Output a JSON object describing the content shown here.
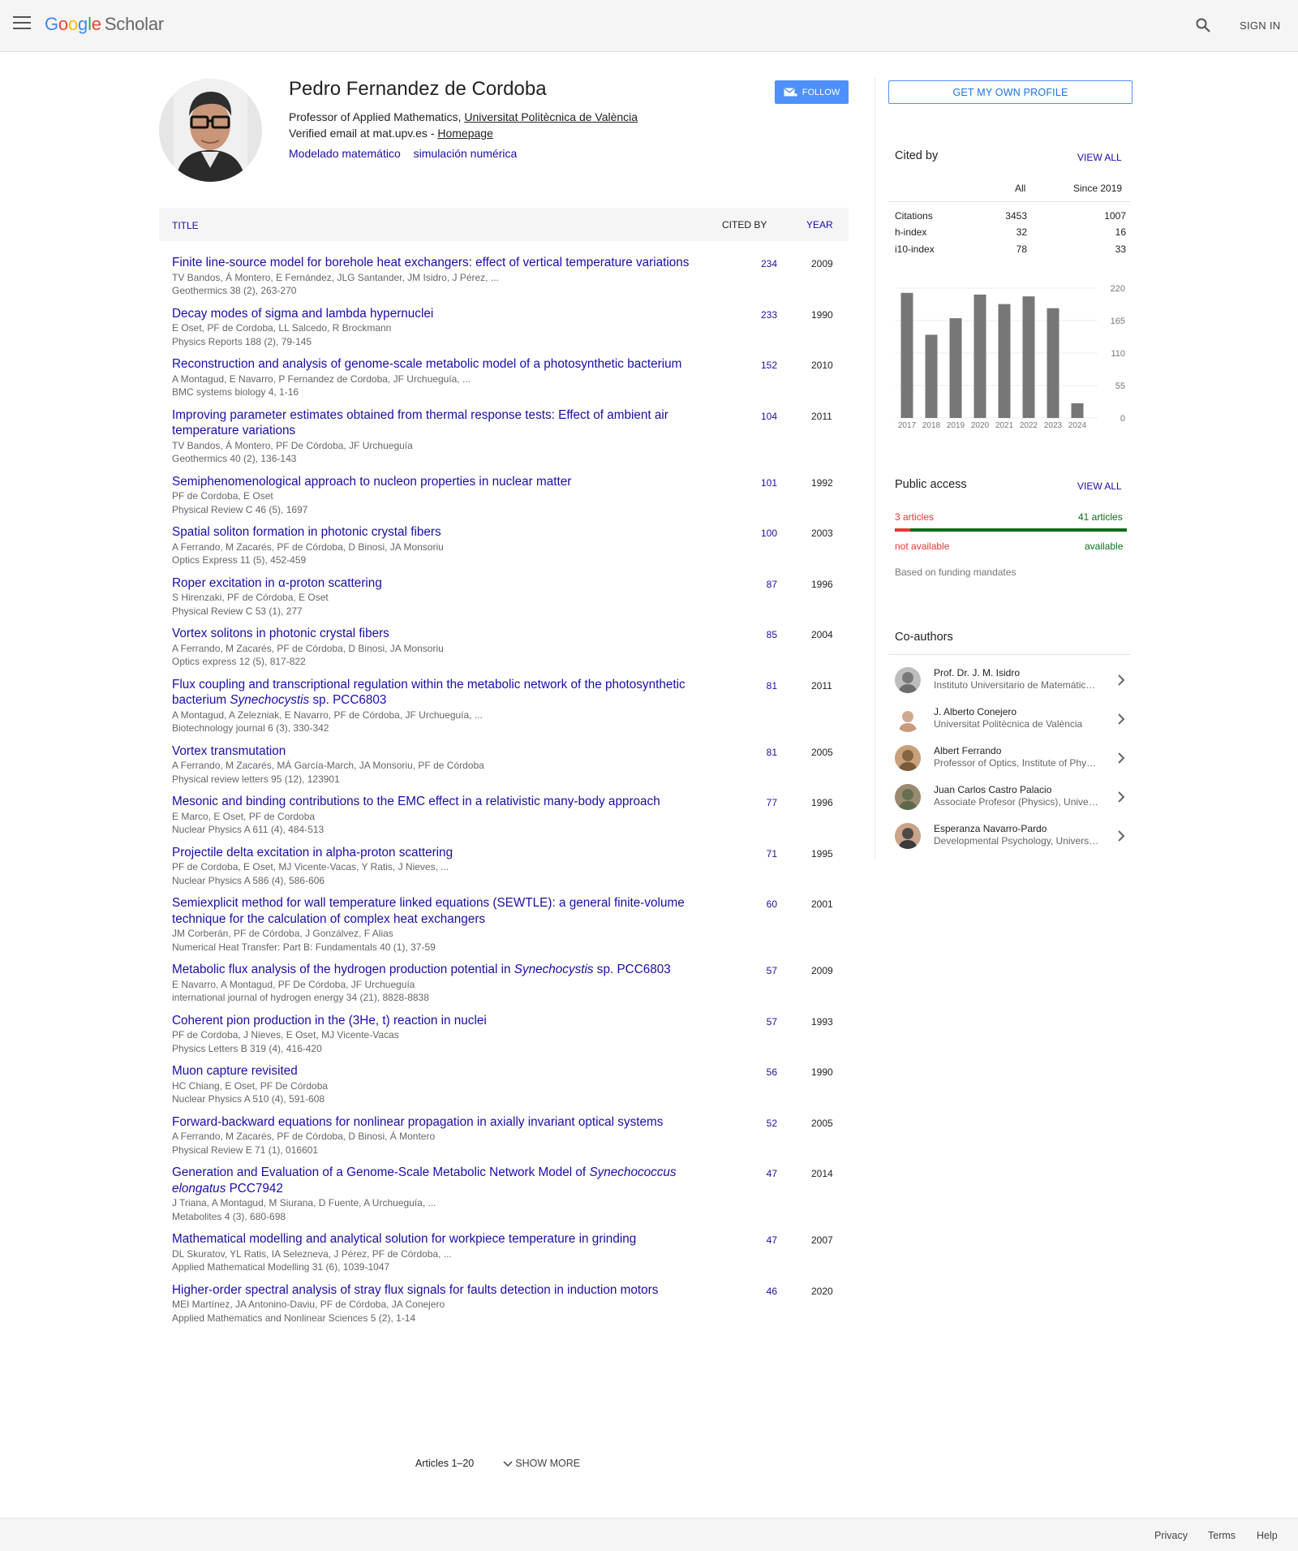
{
  "header": {
    "logo_google": "Google",
    "logo_product": "Scholar",
    "signin_label": "SIGN IN",
    "icons": [
      "menu-icon",
      "search-icon"
    ]
  },
  "profile": {
    "name": "Pedro Fernandez de Cordoba",
    "affiliation_prefix": "Professor of Applied Mathematics, ",
    "affiliation_link": "Universitat Politècnica de València",
    "email_text": "Verified email at mat.upv.es - ",
    "homepage_label": "Homepage",
    "interests": [
      "Modelado matemático",
      "simulación numérica"
    ],
    "follow_label": "FOLLOW"
  },
  "table": {
    "col_title": "TITLE",
    "col_cited": "CITED BY",
    "col_year": "YEAR",
    "rows": [
      {
        "title": "Finite line-source model for borehole heat exchangers: effect of vertical temperature variations",
        "authors": "TV Bandos, Á Montero, E Fernández, JLG Santander, JM Isidro, J Pérez, ...",
        "venue": "Geothermics 38 (2), 263-270",
        "cited": "234",
        "year": "2009"
      },
      {
        "title": "Decay modes of sigma and lambda hypernuclei",
        "authors": "E Oset, PF de Cordoba, LL Salcedo, R Brockmann",
        "venue": "Physics Reports 188 (2), 79-145",
        "cited": "233",
        "year": "1990"
      },
      {
        "title": "Reconstruction and analysis of genome-scale metabolic model of a photosynthetic bacterium",
        "authors": "A Montagud, E Navarro, P Fernandez de Cordoba, JF Urchueguía, ...",
        "venue": "BMC systems biology 4, 1-16",
        "cited": "152",
        "year": "2010"
      },
      {
        "title": "Improving parameter estimates obtained from thermal response tests: Effect of ambient air temperature variations",
        "authors": "TV Bandos, Á Montero, PF De Córdoba, JF Urchueguía",
        "venue": "Geothermics 40 (2), 136-143",
        "cited": "104",
        "year": "2011"
      },
      {
        "title": "Semiphenomenological approach to nucleon properties in nuclear matter",
        "authors": "PF de Cordoba, E Oset",
        "venue": "Physical Review C 46 (5), 1697",
        "cited": "101",
        "year": "1992"
      },
      {
        "title": "Spatial soliton formation in photonic crystal fibers",
        "authors": "A Ferrando, M Zacarés, PF de Córdoba, D Binosi, JA Monsoriu",
        "venue": "Optics Express 11 (5), 452-459",
        "cited": "100",
        "year": "2003"
      },
      {
        "title": "Roper excitation in α-proton scattering",
        "authors": "S Hirenzaki, PF de Córdoba, E Oset",
        "venue": "Physical Review C 53 (1), 277",
        "cited": "87",
        "year": "1996"
      },
      {
        "title": "Vortex solitons in photonic crystal fibers",
        "authors": "A Ferrando, M Zacarés, PF de Córdoba, D Binosi, JA Monsoriu",
        "venue": "Optics express 12 (5), 817-822",
        "cited": "85",
        "year": "2004"
      },
      {
        "title": "Flux coupling and transcriptional regulation within the metabolic network of the photosynthetic bacterium Synechocystis sp. PCC6803",
        "authors": "A Montagud, A Zelezniak, E Navarro, PF de Córdoba, JF Urchueguía, ...",
        "venue": "Biotechnology journal 6 (3), 330-342",
        "cited": "81",
        "year": "2011"
      },
      {
        "title": "Vortex transmutation",
        "authors": "A Ferrando, M Zacarés, MÁ García-March, JA Monsoriu, PF de Córdoba",
        "venue": "Physical review letters 95 (12), 123901",
        "cited": "81",
        "year": "2005"
      },
      {
        "title": "Mesonic and binding contributions to the EMC effect in a relativistic many-body approach",
        "authors": "E Marco, E Oset, PF de Cordoba",
        "venue": "Nuclear Physics A 611 (4), 484-513",
        "cited": "77",
        "year": "1996"
      },
      {
        "title": "Projectile delta excitation in alpha-proton scattering",
        "authors": "PF de Cordoba, E Oset, MJ Vicente-Vacas, Y Ratis, J Nieves, ...",
        "venue": "Nuclear Physics A 586 (4), 586-606",
        "cited": "71",
        "year": "1995"
      },
      {
        "title": "Semiexplicit method for wall temperature linked equations (SEWTLE): a general finite-volume technique for the calculation of complex heat exchangers",
        "authors": "JM Corberán, PF de Córdoba, J Gonzálvez, F Alias",
        "venue": "Numerical Heat Transfer: Part B: Fundamentals 40 (1), 37-59",
        "cited": "60",
        "year": "2001"
      },
      {
        "title": "Metabolic flux analysis of the hydrogen production potential in Synechocystis sp. PCC6803",
        "authors": "E Navarro, A Montagud, PF De Córdoba, JF Urchueguía",
        "venue": "international journal of hydrogen energy 34 (21), 8828-8838",
        "cited": "57",
        "year": "2009"
      },
      {
        "title": "Coherent pion production in the (3He, t) reaction in nuclei",
        "authors": "PF de Cordoba, J Nieves, E Oset, MJ Vicente-Vacas",
        "venue": "Physics Letters B 319 (4), 416-420",
        "cited": "57",
        "year": "1993"
      },
      {
        "title": "Muon capture revisited",
        "authors": "HC Chiang, E Oset, PF De Córdoba",
        "venue": "Nuclear Physics A 510 (4), 591-608",
        "cited": "56",
        "year": "1990"
      },
      {
        "title": "Forward-backward equations for nonlinear propagation in axially invariant optical systems",
        "authors": "A Ferrando, M Zacarés, PF de Córdoba, D Binosi, Á Montero",
        "venue": "Physical Review E 71 (1), 016601",
        "cited": "52",
        "year": "2005"
      },
      {
        "title": "Generation and Evaluation of a Genome-Scale Metabolic Network Model of Synechococcus elongatus PCC7942",
        "authors": "J Triana, A Montagud, M Siurana, D Fuente, A Urchueguía, ...",
        "venue": "Metabolites 4 (3), 680-698",
        "cited": "47",
        "year": "2014"
      },
      {
        "title": "Mathematical modelling and analytical solution for workpiece temperature in grinding",
        "authors": "DL Skuratov, YL Ratis, IA Selezneva, J Pérez, PF de Córdoba, ...",
        "venue": "Applied Mathematical Modelling 31 (6), 1039-1047",
        "cited": "47",
        "year": "2007"
      },
      {
        "title": "Higher-order spectral analysis of stray flux signals for faults detection in induction motors",
        "authors": "MEI Martínez, JA Antonino-Daviu, PF de Córdoba, JA Conejero",
        "venue": "Applied Mathematics and Nonlinear Sciences 5 (2), 1-14",
        "cited": "46",
        "year": "2020"
      }
    ],
    "articles_range": "Articles 1–20",
    "show_more_label": "SHOW MORE"
  },
  "sidebar": {
    "get_profile_label": "GET MY OWN PROFILE",
    "cited_by": {
      "title": "Cited by",
      "view_all": "VIEW ALL",
      "col_all": "All",
      "col_since": "Since 2019",
      "stats": [
        {
          "label": "Citations",
          "all": "3453",
          "since": "1007"
        },
        {
          "label": "h-index",
          "all": "32",
          "since": "16"
        },
        {
          "label": "i10-index",
          "all": "78",
          "since": "33"
        }
      ]
    },
    "public_access": {
      "title": "Public access",
      "view_all": "VIEW ALL",
      "not_available_count": "3 articles",
      "available_count": "41 articles",
      "not_available_label": "not available",
      "available_label": "available",
      "available_fraction": 0.932,
      "note": "Based on funding mandates",
      "colors": {
        "not_available": "#e53935",
        "available": "#0b6e1a"
      }
    },
    "coauthors": {
      "title": "Co-authors",
      "items": [
        {
          "name": "Prof. Dr. J. M. Isidro",
          "affiliation": "Instituto Universitario de Matemática Pura y Aplicada"
        },
        {
          "name": "J. Alberto Conejero",
          "affiliation": "Universitat Politècnica de València"
        },
        {
          "name": "Albert Ferrando",
          "affiliation": "Professor of Optics, Institute of Physics"
        },
        {
          "name": "Juan Carlos Castro Palacio",
          "affiliation": "Associate Profesor (Physics), Universitat"
        },
        {
          "name": "Esperanza Navarro-Pardo",
          "affiliation": "Developmental Psychology, Universitat"
        }
      ]
    }
  },
  "chart_data": {
    "type": "bar",
    "categories": [
      "2017",
      "2018",
      "2019",
      "2020",
      "2021",
      "2022",
      "2023",
      "2024"
    ],
    "values": [
      212,
      141,
      169,
      209,
      193,
      206,
      186,
      25
    ],
    "yticks": [
      "220",
      "165",
      "110",
      "55",
      "0"
    ],
    "ylim": [
      0,
      220
    ],
    "bar_color": "#777777"
  },
  "footer": {
    "links": [
      "Privacy",
      "Terms",
      "Help"
    ]
  }
}
